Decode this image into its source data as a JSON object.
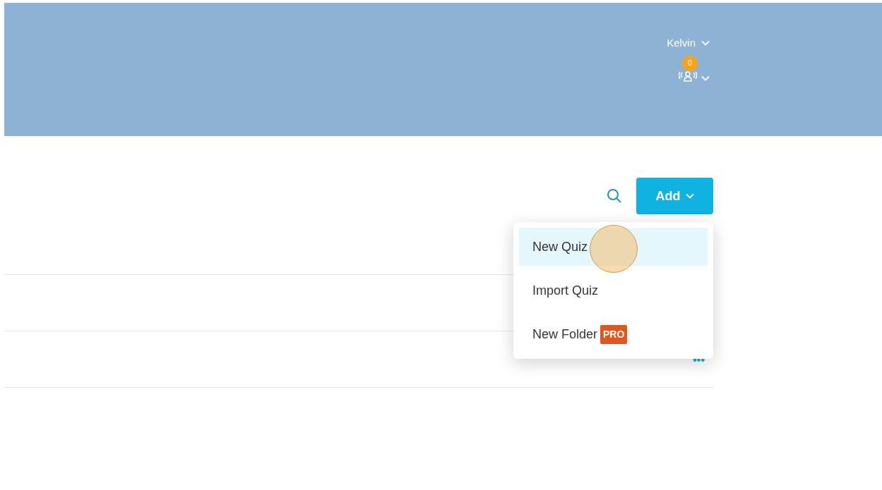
{
  "header": {
    "user": "Kelvin",
    "notifications": "0"
  },
  "toolbar": {
    "add_button": "Add"
  },
  "menu": {
    "items": [
      {
        "label": "New Quiz",
        "selected": true
      },
      {
        "label": "Import Quiz",
        "selected": false
      },
      {
        "label": "New Folder",
        "selected": false,
        "badge": "PRO"
      }
    ]
  },
  "rows": [
    {
      "more": ""
    },
    {
      "more": "•••"
    }
  ]
}
